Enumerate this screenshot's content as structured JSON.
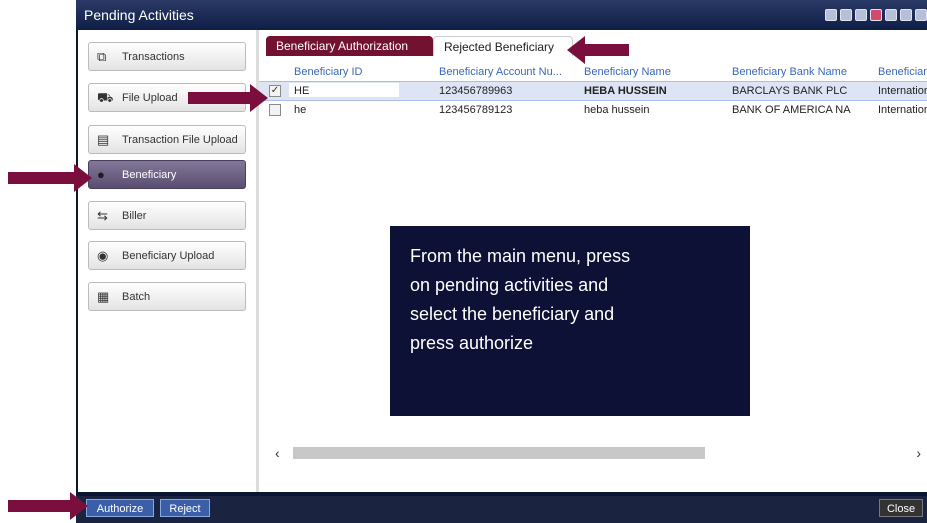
{
  "window": {
    "title": "Pending Activities"
  },
  "sidebar": {
    "items": [
      {
        "label": "Transactions",
        "icon": "transactions-icon"
      },
      {
        "label": "File Upload",
        "icon": "file-upload-icon"
      },
      {
        "label": "Transaction File Upload",
        "icon": "transaction-file-icon"
      },
      {
        "label": "Beneficiary",
        "icon": "beneficiary-icon",
        "active": true
      },
      {
        "label": "Biller",
        "icon": "biller-icon"
      },
      {
        "label": "Beneficiary Upload",
        "icon": "beneficiary-upload-icon"
      },
      {
        "label": "Batch",
        "icon": "batch-icon"
      }
    ]
  },
  "tabs": [
    {
      "label": "Beneficiary Authorization",
      "active": true
    },
    {
      "label": "Rejected Beneficiary",
      "active": false
    }
  ],
  "table": {
    "columns": [
      "Beneficiary ID",
      "Beneficiary Account Nu...",
      "Beneficiary Name",
      "Beneficiary Bank Name",
      "Beneficiar"
    ],
    "rows": [
      {
        "checked": true,
        "id": "HE",
        "account": "123456789963",
        "name": "HEBA HUSSEIN",
        "bank": "BARCLAYS BANK PLC",
        "type": "Internation"
      },
      {
        "checked": false,
        "id": "he",
        "account": "123456789123",
        "name": "heba hussein",
        "bank": "BANK OF AMERICA NA",
        "type": "Internation"
      }
    ]
  },
  "buttons": {
    "authorize": "Authorize",
    "reject": "Reject",
    "close": "Close"
  },
  "overlay": {
    "lines": [
      "From the main menu, press",
      "on pending activities and",
      "select the beneficiary and",
      "press authorize"
    ]
  },
  "colors": {
    "arrow": "#7a0f3d",
    "active_tab": "#731230",
    "header_text": "#3b68b6"
  }
}
